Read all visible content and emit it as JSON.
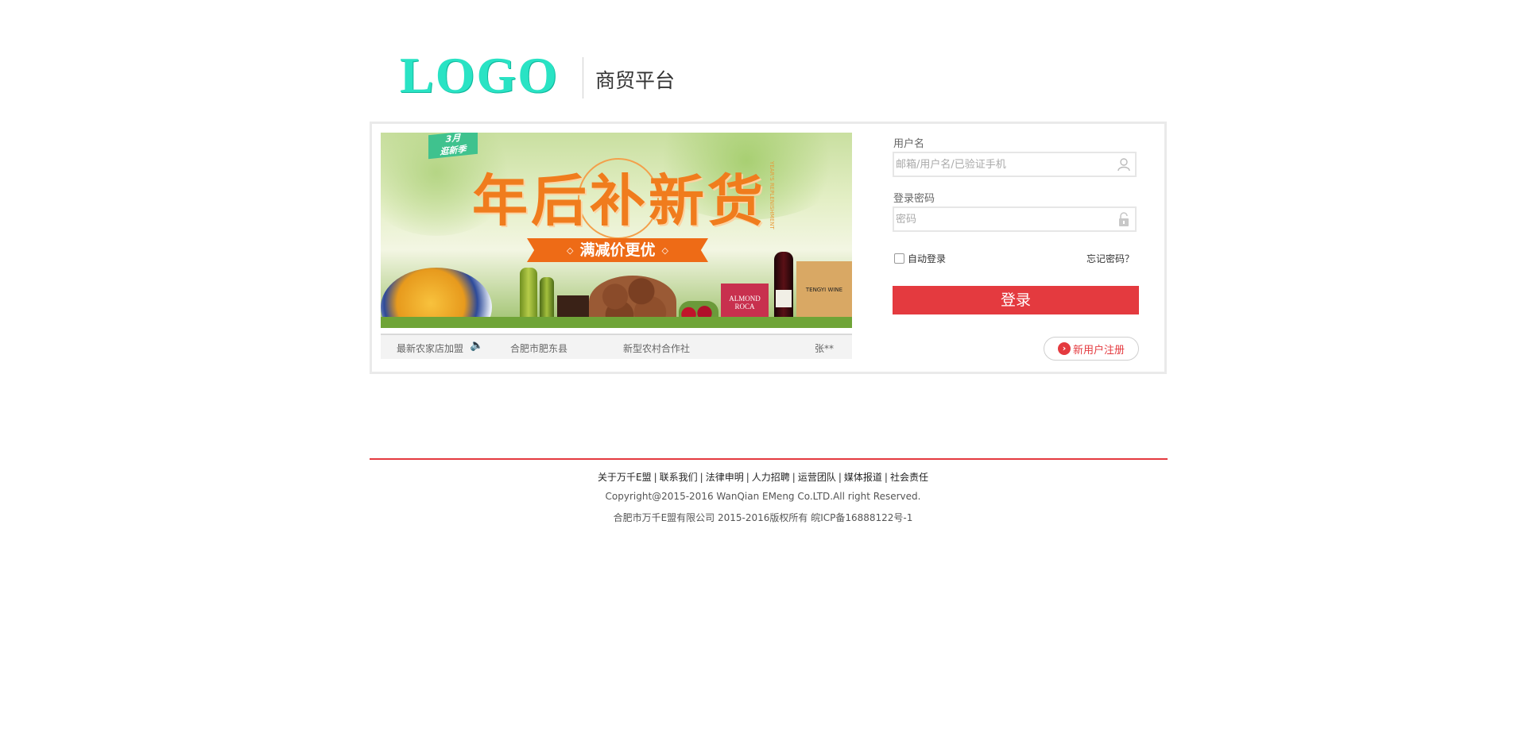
{
  "header": {
    "logo_text": "LOGO",
    "platform_title": "商贸平台"
  },
  "banner": {
    "badge_top": "3月",
    "badge_bottom": "逛新季",
    "heading": "年后补新货",
    "side_text": "YEAR'S REPLENISHMENT",
    "ribbon": "满减价更优",
    "almond_label": "ALMOND ROCA",
    "wine_label": "TENGYI WINE"
  },
  "ticker": {
    "item1": "最新农家店加盟",
    "item2": "合肥市肥东县",
    "item3": "新型农村合作社",
    "item4": "张**"
  },
  "form": {
    "username_label": "用户名",
    "username_placeholder": "邮箱/用户名/已验证手机",
    "password_label": "登录密码",
    "password_placeholder": "密码",
    "remember_label": "自动登录",
    "forgot_label": "忘记密码？",
    "login_button": "登录",
    "register_button": "新用户注册"
  },
  "footer": {
    "links": [
      "关于万千E盟",
      "联系我们",
      "法律申明",
      "人力招聘",
      "运营团队",
      "媒体报道",
      "社会责任"
    ],
    "copyright": "Copyright@2015-2016 WanQian EMeng Co.LTD.All right Reserved.",
    "icp": "合肥市万千E盟有限公司 2015-2016版权所有 皖ICP备16888122号-1"
  },
  "colors": {
    "accent": "#e43a3f",
    "logo": "#29e3c4"
  }
}
